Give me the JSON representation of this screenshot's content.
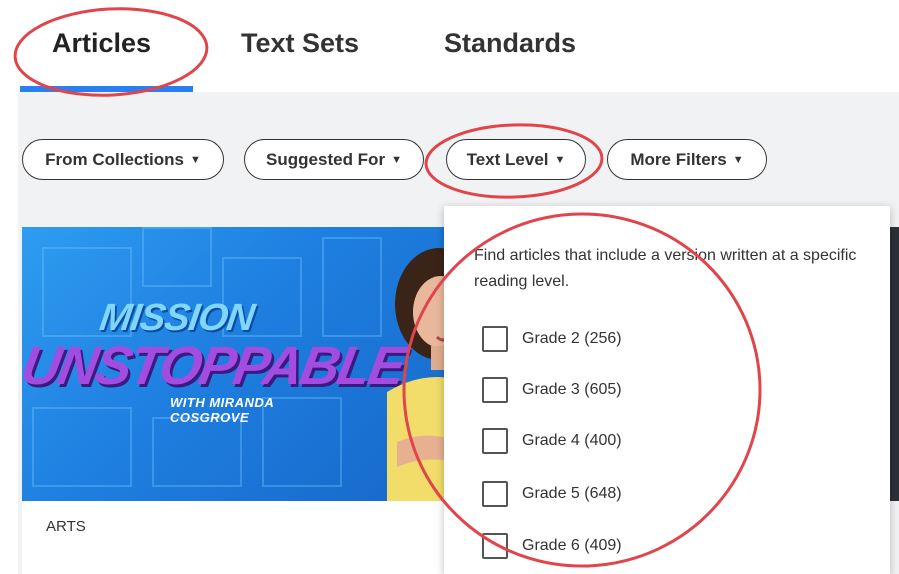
{
  "tabs": [
    {
      "label": "Articles",
      "active": true
    },
    {
      "label": "Text Sets",
      "active": false
    },
    {
      "label": "Standards",
      "active": false
    }
  ],
  "filters": [
    {
      "label": "From Collections"
    },
    {
      "label": "Suggested For"
    },
    {
      "label": "Text Level"
    },
    {
      "label": "More Filters"
    }
  ],
  "card": {
    "logo_line1": "MISSION",
    "logo_line2": "UNSTOPPABLE",
    "logo_line3": "WITH MIRANDA COSGROVE",
    "tag": "ARTS"
  },
  "dropdown": {
    "description": "Find articles that include a version written at a specific reading level.",
    "options": [
      {
        "label": "Grade 2 (256)",
        "checked": false
      },
      {
        "label": "Grade 3 (605)",
        "checked": false
      },
      {
        "label": "Grade 4 (400)",
        "checked": false
      },
      {
        "label": "Grade 5 (648)",
        "checked": false
      },
      {
        "label": "Grade 6 (409)",
        "checked": false
      }
    ]
  },
  "colors": {
    "accent": "#2a7ff0",
    "annotation": "#e0454b",
    "background": "#f1f2f3"
  },
  "icons": {
    "caret": "caret-down-icon",
    "checkbox": "checkbox-icon"
  }
}
